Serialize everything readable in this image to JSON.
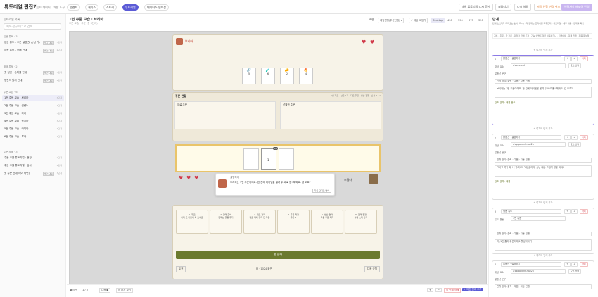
{
  "header": {
    "brand": "튜토리얼 편집기",
    "subtabs": [
      "튜토 데이터",
      "개발 도구"
    ],
    "chips": [
      "볼렌드",
      "캐릭스",
      "스토리",
      "튜토리얼",
      "데이터스 인지문"
    ],
    "buttons": {
      "restart": "레벨 튜토리얼 다시 듣기",
      "shortcut": "되돌리기",
      "reexec": "다시 실행",
      "save_warn": "저장 안함 변경 취소",
      "publish": "변경사항 배포해 반영"
    }
  },
  "left": {
    "header": "튜토리얼 목록",
    "search_placeholder": "제목·문구 태그로 검색",
    "groups": [
      {
        "title": "입문 튜토 · 3",
        "items": [
          {
            "label": "입문 튜토 - 주문 설명(첫 손님 가)",
            "tag": "불구 대표",
            "n": "3단계"
          },
          {
            "label": "입문 튜토 - 관폐 안내",
            "tag": "물건 대표",
            "n": "2단계"
          }
        ]
      },
      {
        "title": "화폐 튜토 · 2",
        "items": [
          {
            "label": "첫 정산 · 손해를 안내",
            "tag": "물건 대표",
            "n": "3단계"
          },
          {
            "label": "평판의 원리 안내",
            "tag": "물건 대표",
            "n": "2단계"
          }
        ]
      },
      {
        "title": "주문 교습 · 6",
        "items": [
          {
            "label": "1번 주문 교습 · 브리아",
            "tag": "",
            "n": "3단계"
          },
          {
            "label": "2번 주문 교습 · 셀렌느",
            "tag": "",
            "n": "3단계"
          },
          {
            "label": "3번 주문 교습 · 아라",
            "tag": "",
            "n": "3단계"
          },
          {
            "label": "4번 주문 교습 · 녹시아",
            "tag": "",
            "n": "3단계"
          },
          {
            "label": "5번 주문 교습 · 라미아",
            "tag": "",
            "n": "3단계"
          },
          {
            "label": "6번 주문 교습 · 루나",
            "tag": "",
            "n": "3단계"
          }
        ]
      },
      {
        "title": "주문 조율 · 3",
        "items": [
          {
            "label": "주문 조율 튜토리얼 · 현장",
            "tag": "",
            "n": "2단계"
          },
          {
            "label": "주문 조율 튜토리얼 · 심사",
            "tag": "",
            "n": "2단계"
          },
          {
            "label": "첫 주문 안내(레이 화면)",
            "tag": "물건 대표",
            "n": "3단계"
          }
        ]
      }
    ]
  },
  "center": {
    "title": "1번 주문 교습 · 브리아",
    "subtitle": "주문 교습 · 주문 (총 3단계)",
    "mode_label": "화면",
    "mode_value": "게임진행(주문진행)",
    "toggle": "대상 고정기",
    "viewports": [
      "Desktop",
      "430",
      "390",
      "375",
      "320"
    ],
    "game": {
      "customer_name": "브리아",
      "items": [
        {
          "icon": "🔗",
          "count": "5"
        },
        {
          "icon": "🧪",
          "count": "6"
        },
        {
          "icon": "🧀",
          "count": "2"
        },
        {
          "icon": "🔥",
          "count": "4"
        }
      ],
      "section_title": "주문 현황",
      "section_meta": "1번 재료 · 남은 1개 · 다음 주문 · 생산 진행 · 순서 2 / 1",
      "panel_left": "재료 주문",
      "panel_right": "선물한 주문",
      "slot_badge": "1/1",
      "slot_count": "1",
      "seller": "스텔라",
      "dialog_title": "설명하기",
      "dialog_text": "브리아는 1번 주문이에요. 한 칸에 아이템을 올려 두 배로 뽑! 해봐요. 감 오죠?",
      "dialog_btn": "다음 단계로 넘어",
      "actions": [
        {
          "title": "1. 재료",
          "desc": "아래 그 버튼에 와 보세요"
        },
        {
          "title": "2. 판매 준비",
          "desc": "판매는 물품 추가"
        },
        {
          "title": "3. 재료 정리",
          "desc": "재료 목록 정리 전 주문"
        },
        {
          "title": "4. 주문 확정",
          "desc": "주문 1"
        },
        {
          "title": "5. 생산 결과",
          "desc": "다음 주문 대기"
        },
        {
          "title": "6. 판매 결정",
          "desc": "아래 소매 단계"
        }
      ],
      "main_btn": "한 할래",
      "foot_left": "도전",
      "foot_mid": "M · 1024 화면",
      "foot_right": "다음 규칙"
    },
    "footer": {
      "prev": "이전",
      "page": "1 / 3",
      "mid_btn1": "다음",
      "mid_btn2": "다시 보기",
      "plus": "+",
      "minus": "−",
      "delete": "이 단계 삭제",
      "add": "+ 이번 단계 추가"
    }
  },
  "right": {
    "title": "단계",
    "desc": "단계 초보자가 따라오는 순서 (지시) · 각 단계는 조작하면 지워진다 · 튜토리얼 · 세부 내용 1단계를 확인",
    "note": "기본 · 주문 · 장 같은 · 대답과 판매 조정 / 기능 설명 단계로 이동하거나 · 되돌아와 · 강제 진행 · 제목 재설정",
    "add_label": "+ 여기에 단계 추가",
    "steps": [
      {
        "num": "1",
        "type": "말풍선 · 설명하기",
        "target_label": "대상 요소",
        "target": "#ex-wand",
        "pick": "요소 선택",
        "text_label": "말풍선 문구",
        "text_value": "진행 방식: 클릭 · 다음 · 자동 진행",
        "body": "브리아는 1번 주문이에요. 한 칸에 아이템을 올려 두 배로 뽑! 해봐요. 감 오죠?",
        "flag": "강조 영역 · 배경 중요"
      },
      {
        "num": "2",
        "type": "말풍선 · 설명하기",
        "target_label": "대상 요소",
        "target": "#opponent-row2h",
        "pick": "요소 선택",
        "text_label": "말풍선 문구",
        "text_value": "진행 방식: 클릭 · 다음 · 자동 진행",
        "body": "그리고 여기 봐, 내 차례! 이 2 단골이야. 손님 대상 그림이 맞을 거야!",
        "flag": "강조 영역 · 배경"
      },
      {
        "num": "3",
        "type": "행동 유도",
        "target_label": "유도 행동",
        "target": "1번 주문",
        "pick": "",
        "text_label": "",
        "text_value": "진행 방식: 클릭 · 다음 · 자동 진행",
        "body": "자, 1번 줄이 주문이에요 활성화하기",
        "flag": ""
      },
      {
        "num": "4",
        "type": "말풍선 · 설명하기",
        "target_label": "대상 요소",
        "target": "#opponent-row2h",
        "pick": "요소 선택",
        "text_label": "말풍선 문구",
        "text_value": "진행 방식: 클릭 · 다음 · 자동 진행",
        "body": "",
        "flag": ""
      }
    ]
  },
  "colors": {
    "accent": "#5b5bd6",
    "danger": "#d13a4a",
    "green": "#6b7a2e",
    "gold": "#e9c46a"
  }
}
